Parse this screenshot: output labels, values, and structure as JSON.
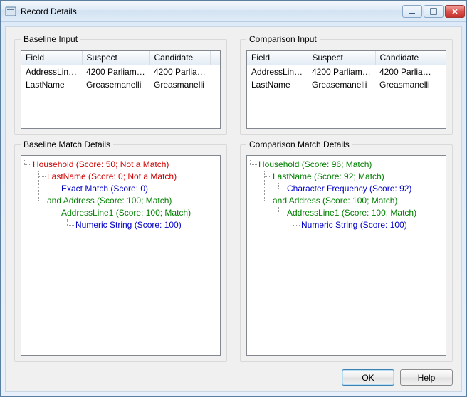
{
  "window": {
    "title": "Record Details"
  },
  "groups": {
    "baseline_input": "Baseline Input",
    "comparison_input": "Comparison Input",
    "baseline_match": "Baseline Match Details",
    "comparison_match": "Comparison Match Details"
  },
  "columns": {
    "field": "Field",
    "suspect": "Suspect",
    "candidate": "Candidate"
  },
  "baseline_input_rows": [
    {
      "field": "AddressLine1",
      "suspect": "4200 Parliame...",
      "candidate": "4200 Parliame..."
    },
    {
      "field": "LastName",
      "suspect": "Greasemanelli",
      "candidate": "Greasmanelli"
    }
  ],
  "comparison_input_rows": [
    {
      "field": "AddressLine1",
      "suspect": "4200 Parliame...",
      "candidate": "4200 Parliame..."
    },
    {
      "field": "LastName",
      "suspect": "Greasemanelli",
      "candidate": "Greasmanelli"
    }
  ],
  "baseline_tree": {
    "n0": "Household (Score: 50; Not a Match)",
    "n1": "LastName (Score: 0; Not a Match)",
    "n2": "Exact Match (Score: 0)",
    "n3": "and Address (Score: 100; Match)",
    "n4": "AddressLine1 (Score: 100; Match)",
    "n5": "Numeric String (Score: 100)"
  },
  "comparison_tree": {
    "n0": "Household (Score: 96; Match)",
    "n1": "LastName (Score: 92; Match)",
    "n2": "Character Frequency (Score: 92)",
    "n3": "and Address (Score: 100; Match)",
    "n4": "AddressLine1 (Score: 100; Match)",
    "n5": "Numeric String (Score: 100)"
  },
  "buttons": {
    "ok": "OK",
    "help": "Help"
  }
}
